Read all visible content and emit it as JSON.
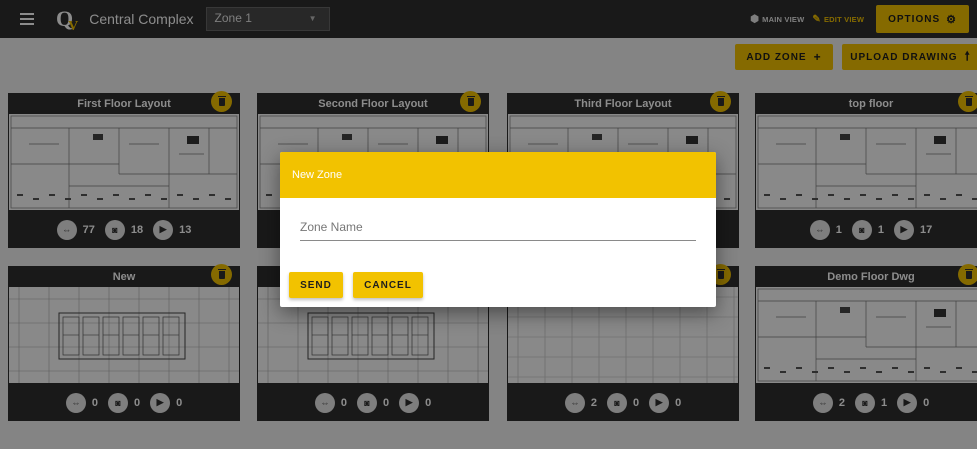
{
  "header": {
    "logo_text": "Q",
    "logo_accent": "V",
    "app_title": "Central Complex",
    "zone_select_value": "Zone 1",
    "main_view_label": "MAIN VIEW",
    "edit_view_label": "EDIT VIEW",
    "options_label": "OPTIONS"
  },
  "actions": {
    "add_zone_label": "ADD ZONE",
    "add_zone_icon": "+",
    "upload_drawing_label": "UPLOAD DRAWING",
    "upload_drawing_icon": "🠕"
  },
  "cards": [
    {
      "title": "First Floor Layout",
      "drawing_style": "office",
      "stats": [
        "77",
        "18",
        "13"
      ]
    },
    {
      "title": "Second Floor Layout",
      "drawing_style": "office",
      "stats": [
        "",
        "",
        ""
      ]
    },
    {
      "title": "Third Floor Layout",
      "drawing_style": "office",
      "stats": [
        "",
        "",
        ""
      ]
    },
    {
      "title": "top floor",
      "drawing_style": "office",
      "stats": [
        "1",
        "1",
        "17"
      ]
    },
    {
      "title": "New",
      "drawing_style": "units",
      "stats": [
        "0",
        "0",
        "0"
      ]
    },
    {
      "title": "",
      "drawing_style": "units",
      "stats": [
        "0",
        "0",
        "0"
      ]
    },
    {
      "title": "",
      "drawing_style": "grid",
      "stats": [
        "2",
        "0",
        "0"
      ]
    },
    {
      "title": "Demo Floor Dwg",
      "drawing_style": "office",
      "stats": [
        "2",
        "1",
        "0"
      ]
    }
  ],
  "dialog": {
    "title": "New Zone",
    "input_placeholder": "Zone Name",
    "input_value": "",
    "send_label": "SEND",
    "cancel_label": "CANCEL"
  },
  "icons": {
    "menu": "hamburger-menu-icon",
    "main_view": "cube-icon",
    "edit_view": "pencil-icon",
    "options": "gear-icon",
    "trash": "trash-icon",
    "stat_1": "location-arrows-icon",
    "stat_2": "camera-icon",
    "stat_3": "play-icon"
  },
  "colors": {
    "accent": "#f2c200",
    "topbar": "#2e2e2e",
    "card": "#2e2e2e",
    "background": "#f1f1f1"
  }
}
